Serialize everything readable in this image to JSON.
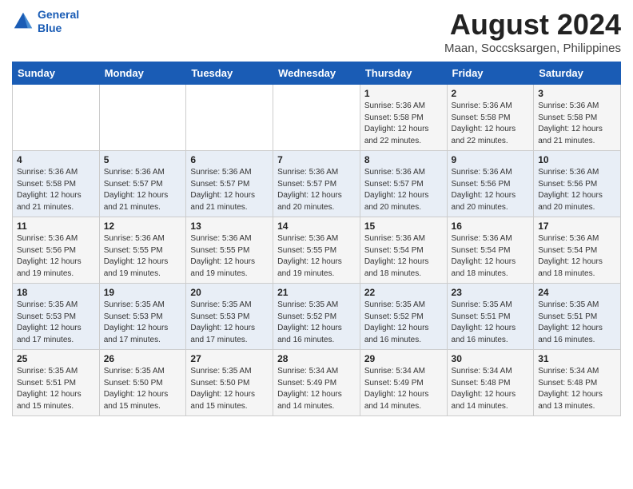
{
  "logo": {
    "line1": "General",
    "line2": "Blue"
  },
  "title": "August 2024",
  "location": "Maan, Soccsksargen, Philippines",
  "weekdays": [
    "Sunday",
    "Monday",
    "Tuesday",
    "Wednesday",
    "Thursday",
    "Friday",
    "Saturday"
  ],
  "weeks": [
    [
      {
        "day": "",
        "info": ""
      },
      {
        "day": "",
        "info": ""
      },
      {
        "day": "",
        "info": ""
      },
      {
        "day": "",
        "info": ""
      },
      {
        "day": "1",
        "info": "Sunrise: 5:36 AM\nSunset: 5:58 PM\nDaylight: 12 hours\nand 22 minutes."
      },
      {
        "day": "2",
        "info": "Sunrise: 5:36 AM\nSunset: 5:58 PM\nDaylight: 12 hours\nand 22 minutes."
      },
      {
        "day": "3",
        "info": "Sunrise: 5:36 AM\nSunset: 5:58 PM\nDaylight: 12 hours\nand 21 minutes."
      }
    ],
    [
      {
        "day": "4",
        "info": "Sunrise: 5:36 AM\nSunset: 5:58 PM\nDaylight: 12 hours\nand 21 minutes."
      },
      {
        "day": "5",
        "info": "Sunrise: 5:36 AM\nSunset: 5:57 PM\nDaylight: 12 hours\nand 21 minutes."
      },
      {
        "day": "6",
        "info": "Sunrise: 5:36 AM\nSunset: 5:57 PM\nDaylight: 12 hours\nand 21 minutes."
      },
      {
        "day": "7",
        "info": "Sunrise: 5:36 AM\nSunset: 5:57 PM\nDaylight: 12 hours\nand 20 minutes."
      },
      {
        "day": "8",
        "info": "Sunrise: 5:36 AM\nSunset: 5:57 PM\nDaylight: 12 hours\nand 20 minutes."
      },
      {
        "day": "9",
        "info": "Sunrise: 5:36 AM\nSunset: 5:56 PM\nDaylight: 12 hours\nand 20 minutes."
      },
      {
        "day": "10",
        "info": "Sunrise: 5:36 AM\nSunset: 5:56 PM\nDaylight: 12 hours\nand 20 minutes."
      }
    ],
    [
      {
        "day": "11",
        "info": "Sunrise: 5:36 AM\nSunset: 5:56 PM\nDaylight: 12 hours\nand 19 minutes."
      },
      {
        "day": "12",
        "info": "Sunrise: 5:36 AM\nSunset: 5:55 PM\nDaylight: 12 hours\nand 19 minutes."
      },
      {
        "day": "13",
        "info": "Sunrise: 5:36 AM\nSunset: 5:55 PM\nDaylight: 12 hours\nand 19 minutes."
      },
      {
        "day": "14",
        "info": "Sunrise: 5:36 AM\nSunset: 5:55 PM\nDaylight: 12 hours\nand 19 minutes."
      },
      {
        "day": "15",
        "info": "Sunrise: 5:36 AM\nSunset: 5:54 PM\nDaylight: 12 hours\nand 18 minutes."
      },
      {
        "day": "16",
        "info": "Sunrise: 5:36 AM\nSunset: 5:54 PM\nDaylight: 12 hours\nand 18 minutes."
      },
      {
        "day": "17",
        "info": "Sunrise: 5:36 AM\nSunset: 5:54 PM\nDaylight: 12 hours\nand 18 minutes."
      }
    ],
    [
      {
        "day": "18",
        "info": "Sunrise: 5:35 AM\nSunset: 5:53 PM\nDaylight: 12 hours\nand 17 minutes."
      },
      {
        "day": "19",
        "info": "Sunrise: 5:35 AM\nSunset: 5:53 PM\nDaylight: 12 hours\nand 17 minutes."
      },
      {
        "day": "20",
        "info": "Sunrise: 5:35 AM\nSunset: 5:53 PM\nDaylight: 12 hours\nand 17 minutes."
      },
      {
        "day": "21",
        "info": "Sunrise: 5:35 AM\nSunset: 5:52 PM\nDaylight: 12 hours\nand 16 minutes."
      },
      {
        "day": "22",
        "info": "Sunrise: 5:35 AM\nSunset: 5:52 PM\nDaylight: 12 hours\nand 16 minutes."
      },
      {
        "day": "23",
        "info": "Sunrise: 5:35 AM\nSunset: 5:51 PM\nDaylight: 12 hours\nand 16 minutes."
      },
      {
        "day": "24",
        "info": "Sunrise: 5:35 AM\nSunset: 5:51 PM\nDaylight: 12 hours\nand 16 minutes."
      }
    ],
    [
      {
        "day": "25",
        "info": "Sunrise: 5:35 AM\nSunset: 5:51 PM\nDaylight: 12 hours\nand 15 minutes."
      },
      {
        "day": "26",
        "info": "Sunrise: 5:35 AM\nSunset: 5:50 PM\nDaylight: 12 hours\nand 15 minutes."
      },
      {
        "day": "27",
        "info": "Sunrise: 5:35 AM\nSunset: 5:50 PM\nDaylight: 12 hours\nand 15 minutes."
      },
      {
        "day": "28",
        "info": "Sunrise: 5:34 AM\nSunset: 5:49 PM\nDaylight: 12 hours\nand 14 minutes."
      },
      {
        "day": "29",
        "info": "Sunrise: 5:34 AM\nSunset: 5:49 PM\nDaylight: 12 hours\nand 14 minutes."
      },
      {
        "day": "30",
        "info": "Sunrise: 5:34 AM\nSunset: 5:48 PM\nDaylight: 12 hours\nand 14 minutes."
      },
      {
        "day": "31",
        "info": "Sunrise: 5:34 AM\nSunset: 5:48 PM\nDaylight: 12 hours\nand 13 minutes."
      }
    ]
  ]
}
